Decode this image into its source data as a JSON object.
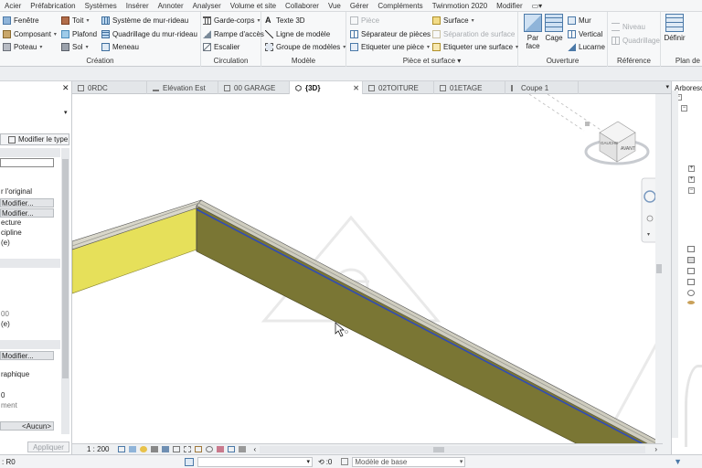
{
  "menu": [
    "Acier",
    "Préfabrication",
    "Systèmes",
    "Insérer",
    "Annoter",
    "Analyser",
    "Volume et site",
    "Collaborer",
    "Vue",
    "Gérer",
    "Compléments",
    "Twinmotion 2020",
    "Modifier"
  ],
  "ribbon": {
    "creation": {
      "title": "Création",
      "items": [
        "Fenêtre",
        "Composant",
        "Poteau",
        "Toit",
        "Plafond",
        "Sol",
        "Système de mur-rideau",
        "Quadrillage du mur-rideau",
        "Meneau"
      ]
    },
    "circulation": {
      "title": "Circulation",
      "items": [
        "Garde-corps",
        "Rampe d'accès",
        "Escalier"
      ]
    },
    "modele": {
      "title": "Modèle",
      "items": [
        "Texte 3D",
        "Ligne de modèle",
        "Groupe de modèles"
      ]
    },
    "piece": {
      "title": "Pièce et surface",
      "items": [
        "Pièce",
        "Séparateur de pièces",
        "Etiqueter une pièce",
        "Surface",
        "Séparation de surface",
        "Etiqueter une surface"
      ]
    },
    "ouverture": {
      "title": "Ouverture",
      "items": [
        "Par face",
        "Cage",
        "Mur",
        "Vertical",
        "Lucarne"
      ]
    },
    "reference": {
      "title": "Référence",
      "items": [
        "Niveau",
        "Quadrillage"
      ]
    },
    "plan": {
      "title": "Plan de",
      "items": [
        "Définir"
      ]
    }
  },
  "left_panel": {
    "modify_type": "Modifier le type",
    "rows": [
      "r l'original",
      "Modifier...",
      "Modifier...",
      "ecture",
      "cipline",
      "(e)",
      "00",
      "(e)",
      "Modifier...",
      "raphique",
      "0",
      "ment",
      "<Aucun>"
    ],
    "apply": "Appliquer"
  },
  "tabs": [
    {
      "label": "0RDC",
      "active": false
    },
    {
      "label": "Elévation Est",
      "active": false
    },
    {
      "label": "00 GARAGE",
      "active": false
    },
    {
      "label": "{3D}",
      "active": true
    },
    {
      "label": "02TOITURE",
      "active": false
    },
    {
      "label": "01ETAGE",
      "active": false
    },
    {
      "label": "Coupe 1",
      "active": false
    }
  ],
  "viewcube": {
    "front": "AVANT",
    "side": "GAUCHE"
  },
  "view_control": {
    "scale": "1 : 200"
  },
  "right_panel": {
    "title": "Arboresc"
  },
  "status": {
    "left": ": R0",
    "zero": ":0",
    "model": "Modèle de base"
  },
  "colors": {
    "accent": "#0060c0",
    "wall_yellow": "#e6e05a",
    "wall_olive": "#7a7634",
    "cap": "#d4d2c6",
    "blue_line": "#2f4bb8"
  }
}
